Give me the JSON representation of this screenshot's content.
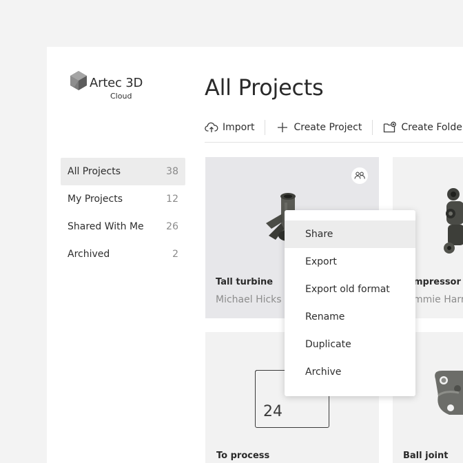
{
  "app": {
    "logo_brand": "Artec 3D",
    "logo_sub": "Cloud"
  },
  "sidebar": {
    "items": [
      {
        "label": "All Projects",
        "count": "38",
        "active": true
      },
      {
        "label": "My Projects",
        "count": "12",
        "active": false
      },
      {
        "label": "Shared With Me",
        "count": "26",
        "active": false
      },
      {
        "label": "Archived",
        "count": "2",
        "active": false
      }
    ]
  },
  "page": {
    "title": "All Projects"
  },
  "toolbar": {
    "import_label": "Import",
    "create_project_label": "Create Project",
    "create_folder_label": "Create Folder"
  },
  "cards": [
    {
      "name": "Tall turbine",
      "owner": "Michael Hicks",
      "icon": "people-icon",
      "type": "model"
    },
    {
      "name": "mpressor",
      "owner": "mmie Harr",
      "type": "model"
    },
    {
      "name": "To process",
      "count": "24",
      "type": "folder"
    },
    {
      "name": "Ball joint",
      "type": "model"
    }
  ],
  "context_menu": {
    "items": [
      {
        "label": "Share",
        "active": true
      },
      {
        "label": "Export",
        "active": false
      },
      {
        "label": "Export old format",
        "active": false
      },
      {
        "label": "Rename",
        "active": false
      },
      {
        "label": "Duplicate",
        "active": false
      },
      {
        "label": "Archive",
        "active": false
      }
    ]
  },
  "colors": {
    "background": "#f3f3f3",
    "panel": "#ffffff",
    "card": "#f2f2f2",
    "card_hover": "#e7e7ea",
    "active_item": "#ececec",
    "muted_text": "#8c8c8c"
  }
}
